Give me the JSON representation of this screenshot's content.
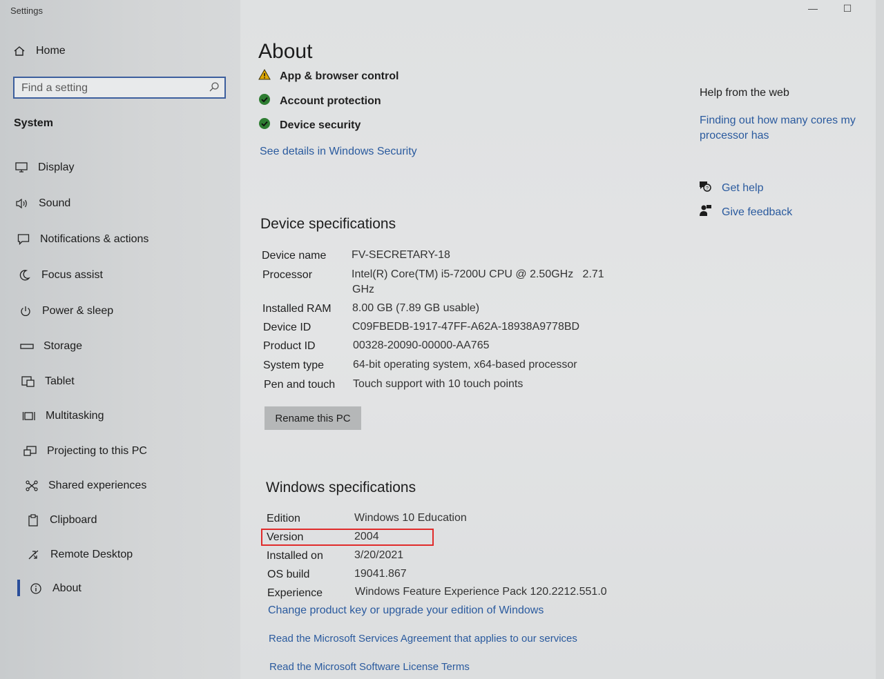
{
  "window": {
    "title": "Settings",
    "minimize": "—",
    "maximize": "☐"
  },
  "sidebar": {
    "home_label": "Home",
    "search_placeholder": "Find a setting",
    "section_label": "System",
    "items": [
      {
        "label": "Display",
        "icon": "display-icon"
      },
      {
        "label": "Sound",
        "icon": "sound-icon"
      },
      {
        "label": "Notifications & actions",
        "icon": "notifications-icon"
      },
      {
        "label": "Focus assist",
        "icon": "moon-icon"
      },
      {
        "label": "Power & sleep",
        "icon": "power-icon"
      },
      {
        "label": "Storage",
        "icon": "storage-icon"
      },
      {
        "label": "Tablet",
        "icon": "tablet-icon"
      },
      {
        "label": "Multitasking",
        "icon": "multitasking-icon"
      },
      {
        "label": "Projecting to this PC",
        "icon": "projecting-icon"
      },
      {
        "label": "Shared experiences",
        "icon": "shared-experiences-icon"
      },
      {
        "label": "Clipboard",
        "icon": "clipboard-icon"
      },
      {
        "label": "Remote Desktop",
        "icon": "remote-desktop-icon"
      },
      {
        "label": "About",
        "icon": "info-icon",
        "active": true
      }
    ]
  },
  "main": {
    "title": "About",
    "security": [
      {
        "label": "App & browser control",
        "status": "warning"
      },
      {
        "label": "Account protection",
        "status": "ok"
      },
      {
        "label": "Device security",
        "status": "ok"
      }
    ],
    "security_link": "See details in Windows Security",
    "device_specs": {
      "heading": "Device specifications",
      "rows": [
        {
          "label": "Device name",
          "value": "FV-SECRETARY-18"
        },
        {
          "label": "Processor",
          "value": "Intel(R) Core(TM) i5-7200U CPU @ 2.50GHz   2.71",
          "value2": "GHz"
        },
        {
          "label": "Installed RAM",
          "value": "8.00 GB (7.89 GB usable)"
        },
        {
          "label": "Device ID",
          "value": "C09FBEDB-1917-47FF-A62A-18938A9778BD"
        },
        {
          "label": "Product ID",
          "value": "00328-20090-00000-AA765"
        },
        {
          "label": "System type",
          "value": "64-bit operating system, x64-based processor"
        },
        {
          "label": "Pen and touch",
          "value": "Touch support with 10 touch points"
        }
      ],
      "rename_button": "Rename this PC"
    },
    "windows_specs": {
      "heading": "Windows specifications",
      "rows": [
        {
          "label": "Edition",
          "value": "Windows 10 Education"
        },
        {
          "label": "Version",
          "value": "2004"
        },
        {
          "label": "Installed on",
          "value": "3/20/2021"
        },
        {
          "label": "OS build",
          "value": "19041.867"
        },
        {
          "label": "Experience",
          "value": "Windows Feature Experience Pack 120.2212.551.0"
        }
      ],
      "links": [
        "Change product key or upgrade your edition of Windows",
        "Read the Microsoft Services Agreement that applies to our services",
        "Read the Microsoft Software License Terms"
      ]
    }
  },
  "aside": {
    "help_title": "Help from the web",
    "help_link": "Finding out how many cores my processor has",
    "get_help": "Get help",
    "give_feedback": "Give feedback"
  },
  "colors": {
    "link": "#2a5a9e",
    "accent": "#2a4e9a",
    "ok": "#2e7d32",
    "warning": "#e0a800",
    "highlight": "#e02a2a"
  }
}
